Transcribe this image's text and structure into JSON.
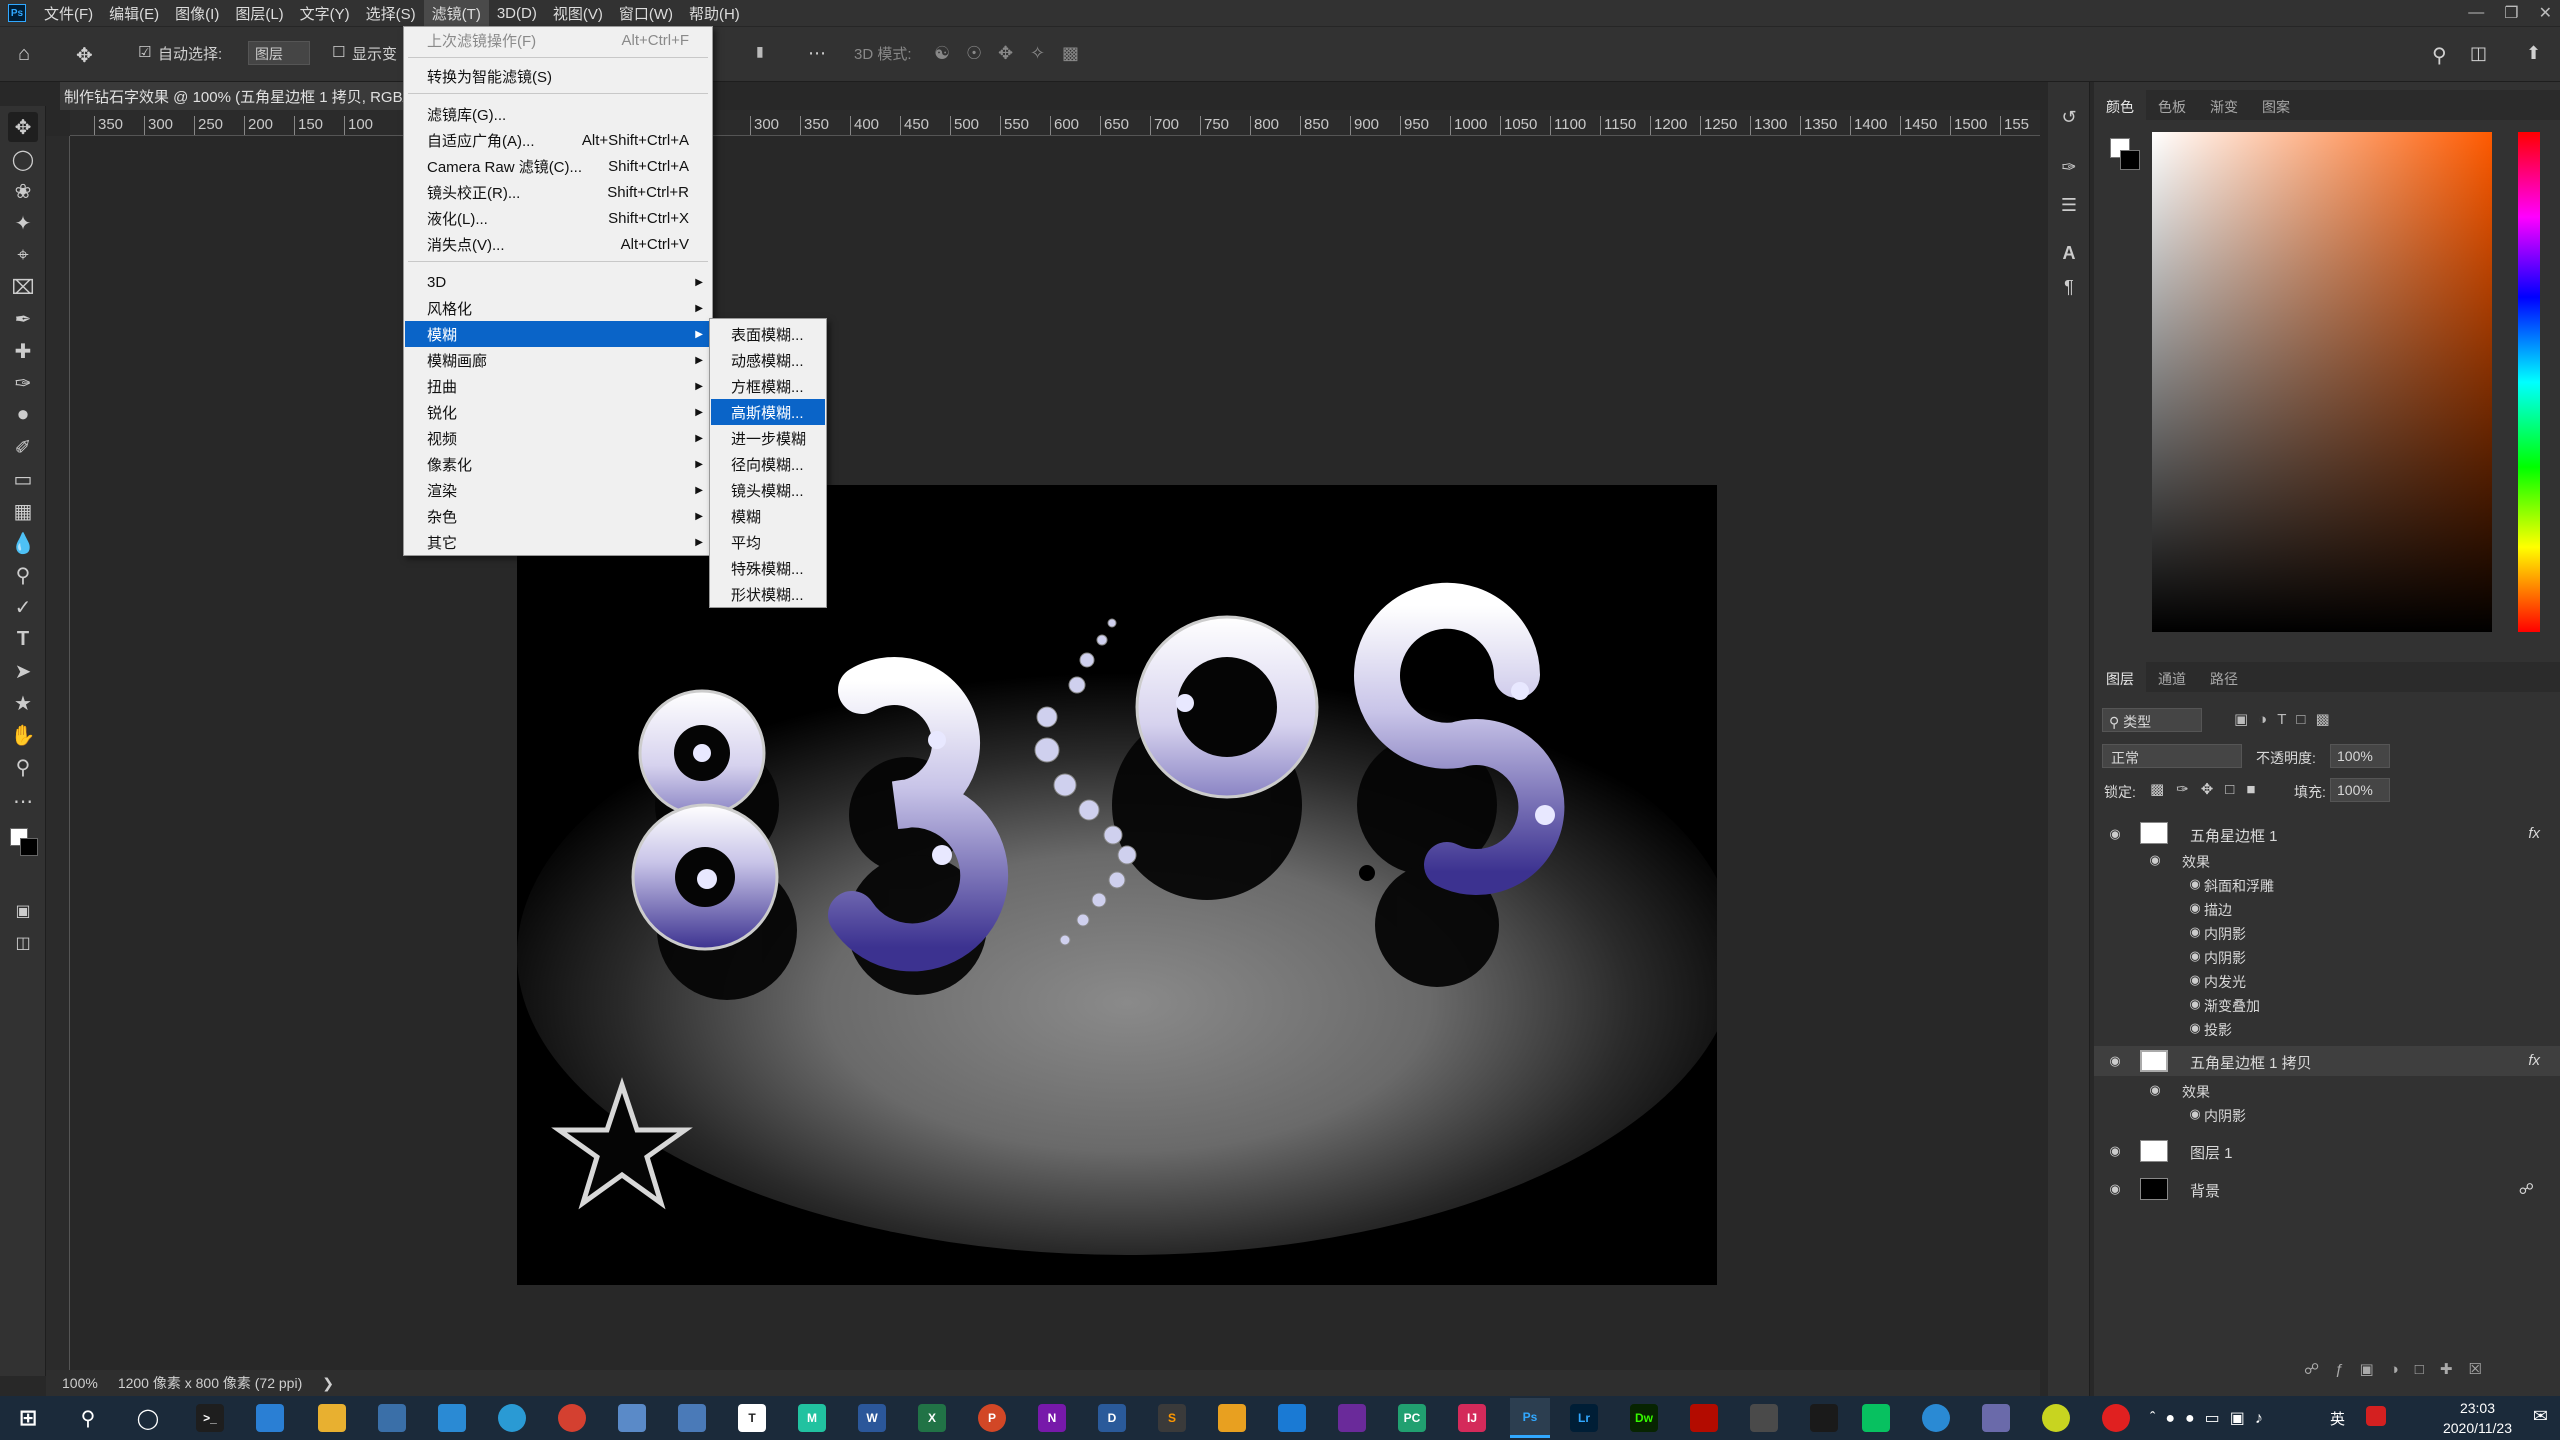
{
  "menubar": {
    "logo": "Ps",
    "items": [
      "文件(F)",
      "编辑(E)",
      "图像(I)",
      "图层(L)",
      "文字(Y)",
      "选择(S)",
      "滤镜(T)",
      "3D(D)",
      "视图(V)",
      "窗口(W)",
      "帮助(H)"
    ],
    "active_index": 6
  },
  "options": {
    "auto_select_label": "自动选择:",
    "auto_select_value": "图层",
    "show_transform_label": "显示变",
    "mode_3d_label": "3D 模式:"
  },
  "document": {
    "tab_title": "制作钻石字效果 @ 100% (五角星边框 1 拷贝, RGB/8"
  },
  "ruler": {
    "h_left": [
      "350",
      "300",
      "250",
      "200",
      "150",
      "100"
    ],
    "h_right": [
      "300",
      "350",
      "400",
      "450",
      "500",
      "550",
      "600",
      "650",
      "700",
      "750",
      "800",
      "850",
      "900",
      "950",
      "1000",
      "1050",
      "1100",
      "1150",
      "1200",
      "1250",
      "1300",
      "1350",
      "1400",
      "1450",
      "1500",
      "155"
    ]
  },
  "status": {
    "zoom": "100%",
    "size": "1200 像素 x 800 像素 (72 ppi)"
  },
  "filter_menu": {
    "items": [
      {
        "label": "上次滤镜操作(F)",
        "shortcut": "Alt+Ctrl+F",
        "disabled": true
      },
      {
        "label": "转换为智能滤镜(S)",
        "shortcut": ""
      },
      {
        "label": "滤镜库(G)...",
        "shortcut": ""
      },
      {
        "label": "自适应广角(A)...",
        "shortcut": "Alt+Shift+Ctrl+A"
      },
      {
        "label": "Camera Raw 滤镜(C)...",
        "shortcut": "Shift+Ctrl+A"
      },
      {
        "label": "镜头校正(R)...",
        "shortcut": "Shift+Ctrl+R"
      },
      {
        "label": "液化(L)...",
        "shortcut": "Shift+Ctrl+X"
      },
      {
        "label": "消失点(V)...",
        "shortcut": "Alt+Ctrl+V"
      },
      {
        "label": "3D",
        "submenu": true
      },
      {
        "label": "风格化",
        "submenu": true
      },
      {
        "label": "模糊",
        "submenu": true,
        "highlighted": true
      },
      {
        "label": "模糊画廊",
        "submenu": true
      },
      {
        "label": "扭曲",
        "submenu": true
      },
      {
        "label": "锐化",
        "submenu": true
      },
      {
        "label": "视频",
        "submenu": true
      },
      {
        "label": "像素化",
        "submenu": true
      },
      {
        "label": "渲染",
        "submenu": true
      },
      {
        "label": "杂色",
        "submenu": true
      },
      {
        "label": "其它",
        "submenu": true
      }
    ]
  },
  "blur_submenu": {
    "items": [
      "表面模糊...",
      "动感模糊...",
      "方框模糊...",
      "高斯模糊...",
      "进一步模糊",
      "径向模糊...",
      "镜头模糊...",
      "模糊",
      "平均",
      "特殊模糊...",
      "形状模糊..."
    ],
    "highlighted_index": 3
  },
  "color_panel": {
    "tabs": [
      "颜色",
      "色板",
      "渐变",
      "图案"
    ],
    "hue_color": "#ff5a00"
  },
  "layers_panel": {
    "tabs": [
      "图层",
      "通道",
      "路径"
    ],
    "filter_label": "类型",
    "blend_mode": "正常",
    "opacity_label": "不透明度:",
    "opacity_value": "100%",
    "lock_label": "锁定:",
    "fill_label": "填充:",
    "fill_value": "100%",
    "layers": [
      {
        "name": "五角星边框 1",
        "fx": "fx",
        "effects_label": "效果",
        "effects": [
          "斜面和浮雕",
          "描边",
          "内阴影",
          "内阴影",
          "内发光",
          "渐变叠加",
          "投影"
        ]
      },
      {
        "name": "五角星边框 1 拷贝",
        "fx": "fx",
        "effects_label": "效果",
        "effects": [
          "内阴影"
        ],
        "selected": true
      },
      {
        "name": "图层 1"
      },
      {
        "name": "背景",
        "locked": true
      }
    ]
  },
  "taskbar": {
    "time": "23:03",
    "date": "2020/11/23",
    "ime": "英",
    "apps": [
      "Ps",
      "Lr",
      "Dw"
    ]
  }
}
